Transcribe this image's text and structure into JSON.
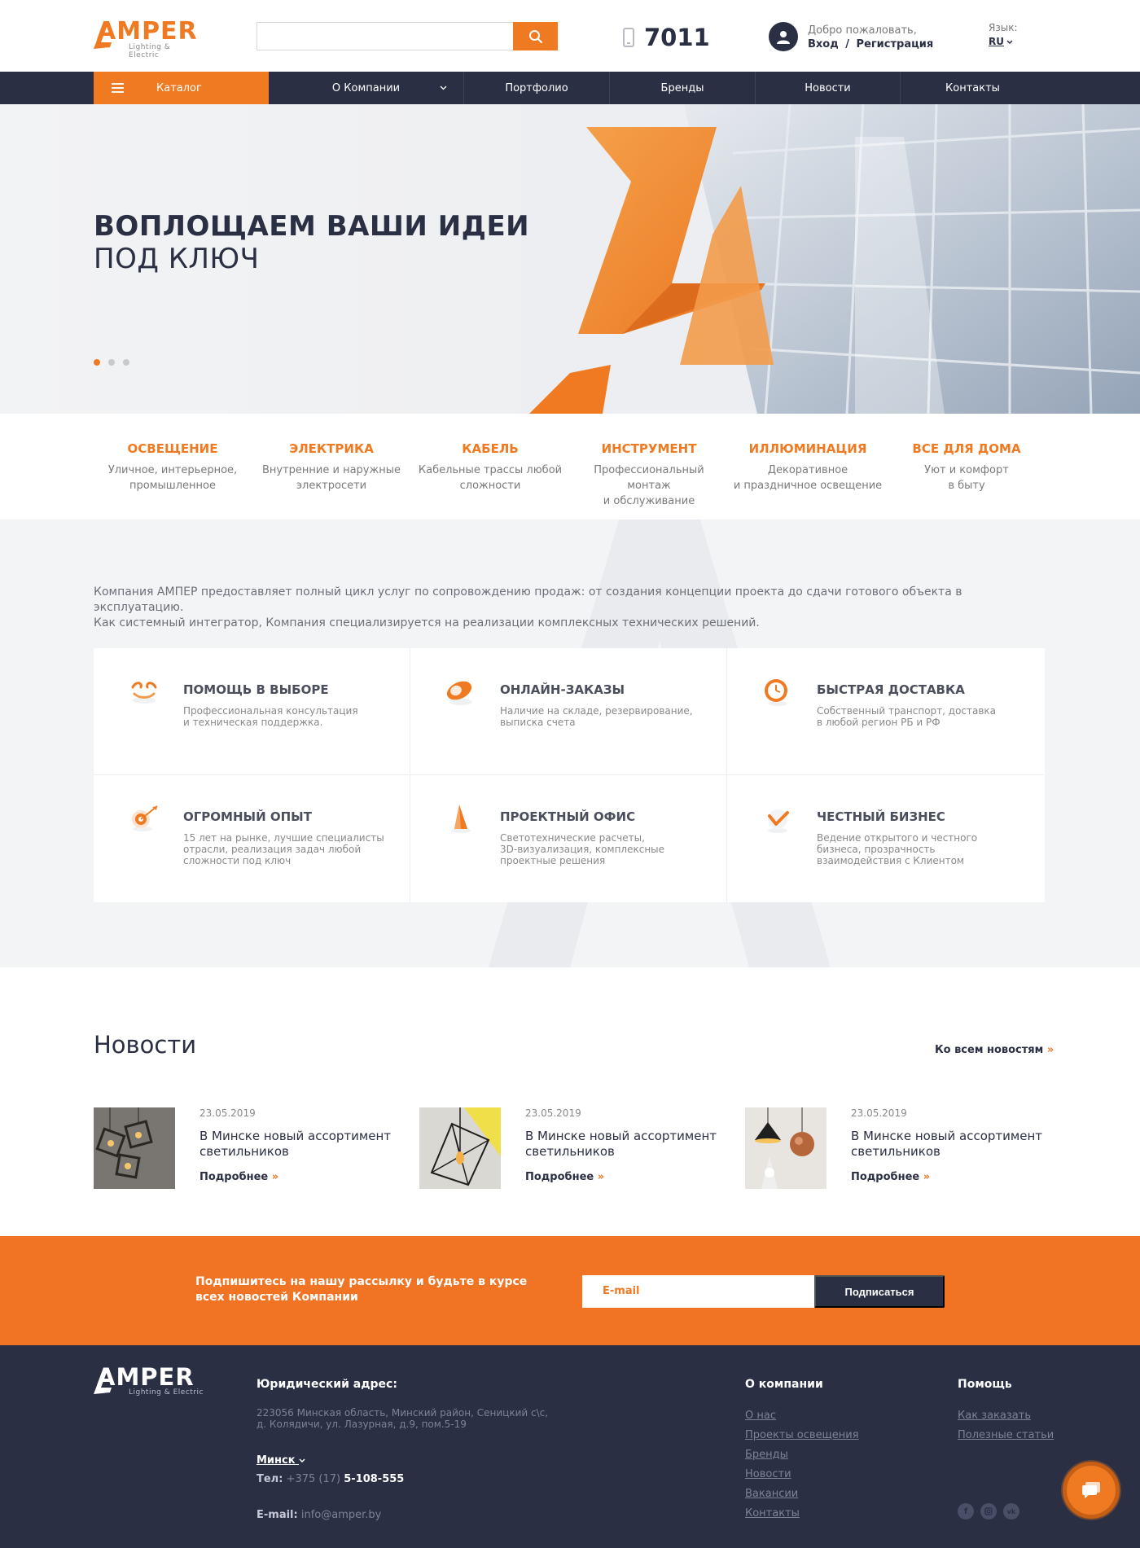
{
  "header": {
    "logo": {
      "word": "AMPER",
      "sub": "Lighting & Electric"
    },
    "search": {
      "placeholder": ""
    },
    "phone": "7011",
    "welcome": {
      "greeting": "Добро пожаловать,",
      "login": "Вход",
      "separator": "/",
      "register": "Регистрация"
    },
    "language": {
      "label": "Язык:",
      "value": "RU"
    }
  },
  "nav": {
    "catalog": "Каталог",
    "items": [
      "О Компании",
      "Портфолио",
      "Бренды",
      "Новости",
      "Контакты"
    ]
  },
  "hero": {
    "title_bold": "ВОПЛОЩАЕМ ВАШИ ИДЕИ",
    "title_light": "ПОД КЛЮЧ",
    "slides": 3,
    "active_slide": 1
  },
  "categories": [
    {
      "title": "ОСВЕЩЕНИЕ",
      "desc1": "Уличное, интерьерное,",
      "desc2": "промышленное"
    },
    {
      "title": "ЭЛЕКТРИКА",
      "desc1": "Внутренние и наружные",
      "desc2": "электросети"
    },
    {
      "title": "КАБЕЛЬ",
      "desc1": "Кабельные трассы любой",
      "desc2": "сложности"
    },
    {
      "title": "ИНСТРУМЕНТ",
      "desc1": "Профессиональный монтаж",
      "desc2": "и обслуживание"
    },
    {
      "title": "ИЛЛЮМИНАЦИЯ",
      "desc1": "Декоративное",
      "desc2": "и праздничное освещение"
    },
    {
      "title": "ВСЕ ДЛЯ ДОМА",
      "desc1": "Уют и комфорт",
      "desc2": "в быту"
    }
  ],
  "about": {
    "line1": "Компания АМПЕР предоставляет полный цикл услуг по сопровождению продаж: от создания концепции проекта до сдачи готового объекта в эксплуатацию.",
    "line2": "Как системный интегратор, Компания специализируется на реализации комплексных технических решений."
  },
  "features": [
    {
      "icon": "help-icon",
      "title": "ПОМОЩЬ В ВЫБОРЕ",
      "d1": "Профессиональная консультация",
      "d2": "и техническая поддержка.",
      "d3": ""
    },
    {
      "icon": "mouse-icon",
      "title": "ОНЛАЙН-ЗАКАЗЫ",
      "d1": "Наличие на складе, резервирование,",
      "d2": "выписка счета",
      "d3": ""
    },
    {
      "icon": "clock-icon",
      "title": "БЫСТРАЯ ДОСТАВКА",
      "d1": "Собственный транспорт, доставка",
      "d2": "в любой регион РБ и РФ",
      "d3": ""
    },
    {
      "icon": "target-icon",
      "title": "ОГРОМНЫЙ ОПЫТ",
      "d1": "15 лет на рынке, лучшие специалисты",
      "d2": "отрасли, реализация задач любой",
      "d3": "сложности под ключ"
    },
    {
      "icon": "pencil-icon",
      "title": "ПРОЕКТНЫЙ ОФИС",
      "d1": "Светотехнические расчеты,",
      "d2": "3D-визуализация, комплексные",
      "d3": "проектные решения"
    },
    {
      "icon": "checkmark-icon",
      "title": "ЧЕСТНЫЙ БИЗНЕС",
      "d1": "Ведение открытого и честного",
      "d2": "бизнеса, прозрачность",
      "d3": "взаимодействия с Клиентом"
    }
  ],
  "news": {
    "heading": "Новости",
    "all_link": "Ко всем новостям",
    "raquo": "»",
    "items": [
      {
        "date": "23.05.2019",
        "title": "В Минске новый ассортимент светильников",
        "more": "Подробнее"
      },
      {
        "date": "23.05.2019",
        "title": "В Минске новый ассортимент светильников",
        "more": "Подробнее"
      },
      {
        "date": "23.05.2019",
        "title": "В Минске новый ассортимент светильников",
        "more": "Подробнее"
      }
    ]
  },
  "subscribe": {
    "text": "Подпишитесь на нашу рассылку и будьте в курсе всех новостей Компании",
    "placeholder": "E-mail",
    "button": "Подписаться"
  },
  "footer": {
    "logo": {
      "word": "AMPER",
      "sub": "Lighting & Electric"
    },
    "address_heading": "Юридический адрес:",
    "address1": "223056 Минская область, Минский район, Сеницкий с\\с,",
    "address2": "д. Колядичи, ул. Лазурная, д.9, пом.5-19",
    "city": "Минск",
    "tel_label": "Тел:",
    "tel_code": "+375 (17)",
    "tel_number": "5-108-555",
    "email_label": "E-mail:",
    "email": "info@amper.by",
    "company_heading": "О компании",
    "company_links": [
      "О нас",
      "Проекты освещения",
      "Бренды",
      "Новости",
      "Вакансии",
      "Контакты"
    ],
    "help_heading": "Помощь",
    "help_links": [
      "Как заказать",
      "Полезные статьи"
    ],
    "socials": [
      "facebook-icon",
      "instagram-icon",
      "vk-icon"
    ]
  },
  "colors": {
    "accent": "#f07a22",
    "dark": "#2b2f44",
    "light_bg": "#f3f4f6"
  }
}
